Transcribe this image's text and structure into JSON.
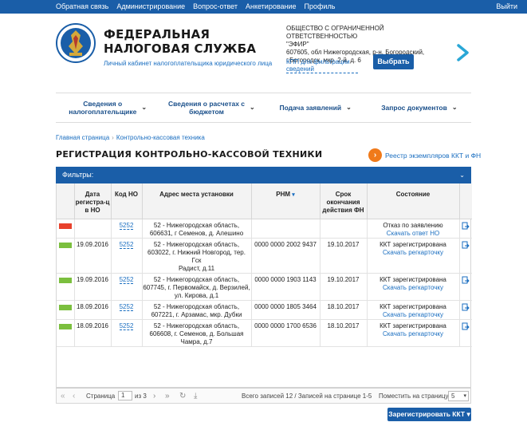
{
  "topbar": {
    "links": [
      "Обратная связь",
      "Администрирование",
      "Вопрос-ответ",
      "Анкетирование",
      "Профиль"
    ],
    "exit": "Выйти"
  },
  "brand": {
    "title_line1": "ФЕДЕРАЛЬНАЯ",
    "title_line2": "НАЛОГОВАЯ СЛУЖБА",
    "subtitle": "Личный кабинет налогоплательщика юридического лица"
  },
  "org": {
    "name_line1": "ОБЩЕСТВО С ОГРАНИЧЕННОЙ ОТВЕТСТВЕННОСТЬЮ",
    "name_line2": "\"ЭФИР\"",
    "address_line1": "607605, обл Нижегородская, р-н. Богородский,",
    "address_line2": "г.Богородск, мкр. 2-й, д. 6",
    "kpp_link": "КПП для фильтрации сведений",
    "choose_button": "Выбрать"
  },
  "nav": [
    {
      "line1": "Сведения о",
      "line2": "налогоплательщике"
    },
    {
      "line1": "Сведения о расчетах с",
      "line2": "бюджетом"
    },
    {
      "line1": "Подача заявлений",
      "line2": ""
    },
    {
      "line1": "Запрос документов",
      "line2": ""
    }
  ],
  "breadcrumb": {
    "home": "Главная страница",
    "current": "Контрольно-кассовая техника"
  },
  "page_title": "РЕГИСТРАЦИЯ КОНТРОЛЬНО-КАССОВОЙ ТЕХНИКИ",
  "registry_link": "Реестр экземпляров ККТ и ФН",
  "filters_label": "Фильтры:",
  "table": {
    "headers": {
      "date": [
        "Дата",
        "регистра-ц",
        "в НО"
      ],
      "code": "Код НО",
      "address": "Адрес места установки",
      "rnm": "РНМ",
      "term": [
        "Срок",
        "окончания",
        "действия ФН"
      ],
      "state": "Состояние"
    },
    "rows": [
      {
        "status_color": "#e8412c",
        "date": "",
        "code": "5252",
        "address": [
          "52 - Нижегородская область,",
          "606631, г Семенов, д. Алешино"
        ],
        "rnm": "",
        "term": "",
        "state": "Отказ по заявлению",
        "link": "Скачать ответ НО"
      },
      {
        "status_color": "#7bbf3e",
        "date": "19.09.2016",
        "code": "5252",
        "address": [
          "52 - Нижегородская область,",
          "603022, г. Нижний Новгород, тер. Гск",
          "Радист, д.11"
        ],
        "rnm": "0000 0000 2002 9437",
        "term": "19.10.2017",
        "state": "ККТ зарегистрирована",
        "link": "Скачать регкарточку"
      },
      {
        "status_color": "#7bbf3e",
        "date": "19.09.2016",
        "code": "5252",
        "address": [
          "52 - Нижегородская область,",
          "607745, г. Первомайск, д. Верзилей,",
          "ул. Кирова, д.1"
        ],
        "rnm": "0000 0000 1903 1143",
        "term": "19.10.2017",
        "state": "ККТ зарегистрирована",
        "link": "Скачать регкарточку"
      },
      {
        "status_color": "#7bbf3e",
        "date": "18.09.2016",
        "code": "5252",
        "address": [
          "52 - Нижегородская область,",
          "607221, г. Арзамас, мкр. Дубки"
        ],
        "rnm": "0000 0000 1805 3464",
        "term": "18.10.2017",
        "state": "ККТ зарегистрирована",
        "link": "Скачать регкарточку"
      },
      {
        "status_color": "#7bbf3e",
        "date": "18.09.2016",
        "code": "5252",
        "address": [
          "52 - Нижегородская область,",
          "606608, г. Семенов, д. Большая",
          "Чамра, д.7"
        ],
        "rnm": "0000 0000 1700 6536",
        "term": "18.10.2017",
        "state": "ККТ зарегистрирована",
        "link": "Скачать регкарточку"
      }
    ]
  },
  "pager": {
    "page_label": "Страница",
    "page_value": "1",
    "of_label": "из 3",
    "info": "Всего записей 12 / Записей на странице 1-5",
    "per_page_label": "Поместить на страницу:",
    "per_page_value": "5"
  },
  "register_button": "Зарегистрировать ККТ"
}
